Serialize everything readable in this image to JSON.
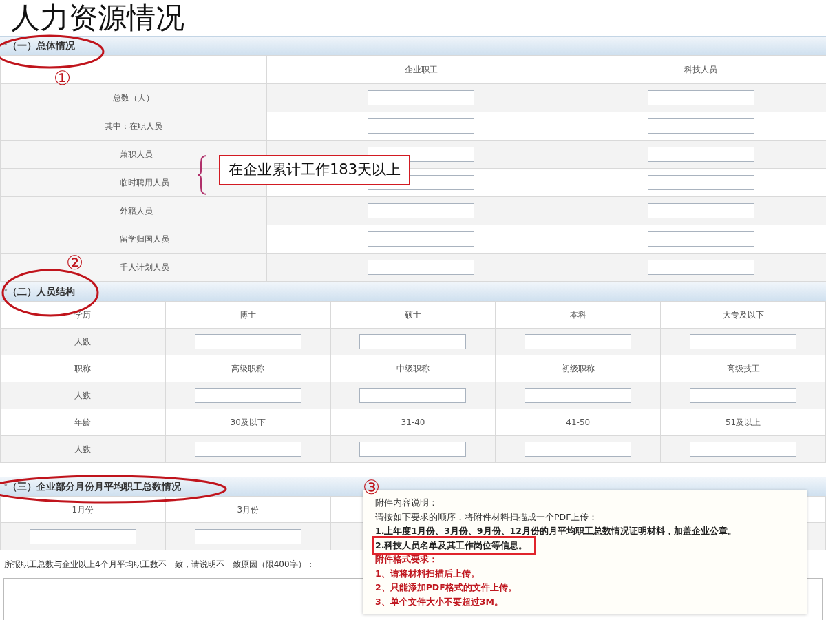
{
  "page_title": "人力资源情况",
  "sections": [
    {
      "kind": "overview",
      "marker": "*",
      "title": "（一）总体情况",
      "number": "①",
      "highlighted": true,
      "columns": [
        "企业职工",
        "科技人员"
      ],
      "rows": [
        {
          "label": "总数（人）",
          "indented": false
        },
        {
          "label": "其中：在职人员",
          "indented": false
        },
        {
          "label": "兼职人员",
          "indented": true
        },
        {
          "label": "临时聘用人员",
          "indented": true
        },
        {
          "label": "外籍人员",
          "indented": true
        },
        {
          "label": "留学归国人员",
          "indented": true
        },
        {
          "label": "千人计划人员",
          "indented": true
        }
      ],
      "callout": "在企业累计工作183天以上"
    },
    {
      "kind": "structure",
      "marker": "*",
      "title": "（二）人员结构",
      "number": "②",
      "highlighted": true,
      "groups": [
        {
          "cells": [
            "学历",
            "博士",
            "硕士",
            "本科",
            "大专及以下"
          ],
          "count_label": "人数"
        },
        {
          "cells": [
            "职称",
            "高级职称",
            "中级职称",
            "初级职称",
            "高级技工"
          ],
          "count_label": "人数"
        },
        {
          "cells": [
            "年龄",
            "30及以下",
            "31-40",
            "41-50",
            "51及以上"
          ],
          "count_label": "人数"
        }
      ]
    },
    {
      "kind": "monthly",
      "marker": "*",
      "title": "（三）企业部分月份月平均职工总数情况",
      "number": "③",
      "highlighted": true,
      "columns": [
        "1月份",
        "3月份"
      ],
      "note": "所报职工总数与企业以上4个月平均职工数不一致，请说明不一致原因（限400字）：",
      "popup": [
        {
          "kind": "plain",
          "text": "附件内容说明：",
          "boxed": false
        },
        {
          "kind": "plain",
          "text": "请按如下要求的顺序，将附件材料扫描成一个PDF上传：",
          "boxed": false
        },
        {
          "kind": "bold",
          "text": "1.上年度1月份、3月份、9月份、12月份的月平均职工总数情况证明材料，加盖企业公章。",
          "boxed": false
        },
        {
          "kind": "bold",
          "text": "2.科技人员名单及其工作岗位等信息。",
          "boxed": true
        },
        {
          "kind": "red",
          "text": "附件格式要求：",
          "boxed": false
        },
        {
          "kind": "red",
          "text": "1、请将材料扫描后上传。",
          "boxed": false
        },
        {
          "kind": "red",
          "text": "2、只能添加PDF格式的文件上传。",
          "boxed": false
        },
        {
          "kind": "red",
          "text": "3、单个文件大小不要超过3M。",
          "boxed": false
        }
      ]
    }
  ]
}
